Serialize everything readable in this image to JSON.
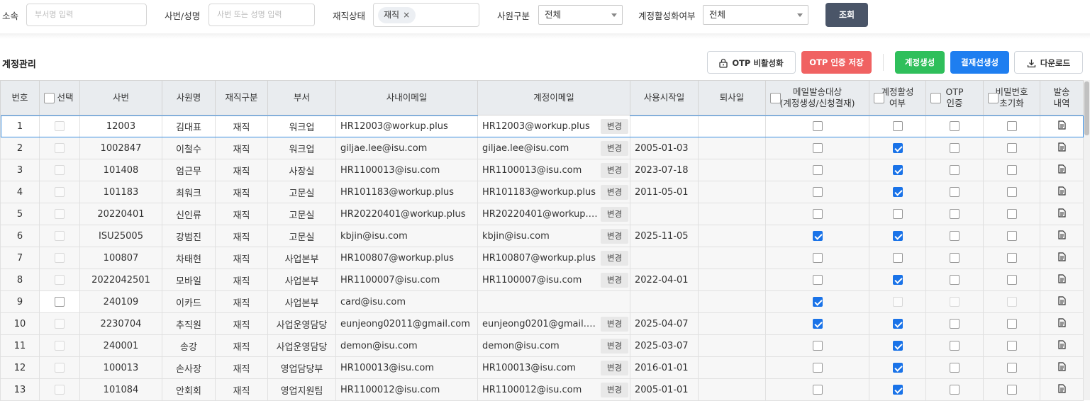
{
  "filters": {
    "org_label": "소속",
    "org_placeholder": "부서명 입력",
    "emp_label": "사번/성명",
    "emp_placeholder": "사번 또는 성명 입력",
    "status_label": "재직상태",
    "status_chip": "재직",
    "chip_remove": "×",
    "type_label": "사원구분",
    "type_value": "전체",
    "active_label": "계정활성화여부",
    "active_value": "전체",
    "search_button": "조회"
  },
  "section": {
    "title": "계정관리",
    "otp_disable": "OTP 비활성화",
    "otp_save": "OTP 인증 저장",
    "create_account": "계정생성",
    "create_approver": "결재선생성",
    "download": "다운로드"
  },
  "colors": {
    "search_button": "#4a5568",
    "otp_save": "#f06262",
    "create_account": "#2fbf5b",
    "create_approver": "#1e7ef0",
    "checkbox_checked": "#1a73e8"
  },
  "icons": [
    "lock-icon",
    "download-icon",
    "document-icon",
    "close-icon",
    "chevron-down-icon"
  ],
  "table": {
    "headers": {
      "no": "번호",
      "select": "선택",
      "emp_no": "사번",
      "name": "사원명",
      "status": "재직구분",
      "dept": "부서",
      "email": "사내이메일",
      "account_email": "계정이메일",
      "start_date": "사용시작일",
      "end_date": "퇴사일",
      "mail_target_1": "메일발송대상",
      "mail_target_2": "(계정생성/신청결재)",
      "active_1": "계정활성",
      "active_2": "여부",
      "otp_1": "OTP",
      "otp_2": "인증",
      "pw_reset_1": "비밀번호",
      "pw_reset_2": "초기화",
      "history_1": "발송",
      "history_2": "내역"
    },
    "change_label": "변경",
    "rows": [
      {
        "no": "1",
        "emp_no": "12003",
        "name": "김대표",
        "status": "재직",
        "dept": "워크업",
        "email": "HR12003@workup.plus",
        "account_email": "HR12003@workup.plus",
        "start_date": "",
        "end_date": "",
        "mail": false,
        "active": false,
        "otp": false,
        "pw": false
      },
      {
        "no": "2",
        "emp_no": "1002847",
        "name": "이철수",
        "status": "재직",
        "dept": "워크업",
        "email": "giljae.lee@isu.com",
        "account_email": "giljae.lee@isu.com",
        "start_date": "2005-01-03",
        "end_date": "",
        "mail": false,
        "active": true,
        "otp": false,
        "pw": false
      },
      {
        "no": "3",
        "emp_no": "101408",
        "name": "엄근무",
        "status": "재직",
        "dept": "사장실",
        "email": "HR1100013@isu.com",
        "account_email": "HR1100013@isu.com",
        "start_date": "2023-07-18",
        "end_date": "",
        "mail": false,
        "active": true,
        "otp": false,
        "pw": false
      },
      {
        "no": "4",
        "emp_no": "101183",
        "name": "최워크",
        "status": "재직",
        "dept": "고문실",
        "email": "HR101183@workup.plus",
        "account_email": "HR101183@workup.plus",
        "start_date": "2011-05-01",
        "end_date": "",
        "mail": false,
        "active": true,
        "otp": false,
        "pw": false
      },
      {
        "no": "5",
        "emp_no": "20220401",
        "name": "신인류",
        "status": "재직",
        "dept": "고문실",
        "email": "HR20220401@workup.plus",
        "account_email": "HR20220401@workup.…",
        "start_date": "",
        "end_date": "",
        "mail": false,
        "active": false,
        "otp": false,
        "pw": false
      },
      {
        "no": "6",
        "emp_no": "ISU25005",
        "name": "강범진",
        "status": "재직",
        "dept": "고문실",
        "email": "kbjin@isu.com",
        "account_email": "kbjin@isu.com",
        "start_date": "2025-11-05",
        "end_date": "",
        "mail": true,
        "active": true,
        "otp": false,
        "pw": false
      },
      {
        "no": "7",
        "emp_no": "100807",
        "name": "차태현",
        "status": "재직",
        "dept": "사업본부",
        "email": "HR100807@workup.plus",
        "account_email": "HR100807@workup.plus",
        "start_date": "",
        "end_date": "",
        "mail": false,
        "active": false,
        "otp": false,
        "pw": false
      },
      {
        "no": "8",
        "emp_no": "2022042501",
        "name": "모바일",
        "status": "재직",
        "dept": "사업본부",
        "email": "HR1100007@isu.com",
        "account_email": "HR1100007@isu.com",
        "start_date": "2022-04-01",
        "end_date": "",
        "mail": false,
        "active": true,
        "otp": false,
        "pw": false
      },
      {
        "no": "9",
        "emp_no": "240109",
        "name": "이카드",
        "status": "재직",
        "dept": "사업본부",
        "email": "card@isu.com",
        "account_email": "",
        "start_date": "",
        "end_date": "",
        "mail": true,
        "active": false,
        "otp": false,
        "pw": false
      },
      {
        "no": "10",
        "emp_no": "2230704",
        "name": "추직원",
        "status": "재직",
        "dept": "사업운영담당",
        "email": "eunjeong02011@gmail.com",
        "account_email": "eunjeong0201@gmail.c…",
        "start_date": "2025-04-07",
        "end_date": "",
        "mail": true,
        "active": true,
        "otp": false,
        "pw": false
      },
      {
        "no": "11",
        "emp_no": "240001",
        "name": "송강",
        "status": "재직",
        "dept": "사업운영담당",
        "email": "demon@isu.com",
        "account_email": "demon@isu.com",
        "start_date": "2025-03-07",
        "end_date": "",
        "mail": false,
        "active": true,
        "otp": false,
        "pw": false
      },
      {
        "no": "12",
        "emp_no": "100013",
        "name": "손사장",
        "status": "재직",
        "dept": "영업담당부",
        "email": "HR100013@isu.com",
        "account_email": "HR100013@isu.com",
        "start_date": "2016-01-01",
        "end_date": "",
        "mail": false,
        "active": true,
        "otp": false,
        "pw": false
      },
      {
        "no": "13",
        "emp_no": "101084",
        "name": "안회회",
        "status": "재직",
        "dept": "영업지원팀",
        "email": "HR1100012@isu.com",
        "account_email": "HR1100012@isu.com",
        "start_date": "2005-01-01",
        "end_date": "",
        "mail": false,
        "active": true,
        "otp": false,
        "pw": false
      }
    ]
  }
}
